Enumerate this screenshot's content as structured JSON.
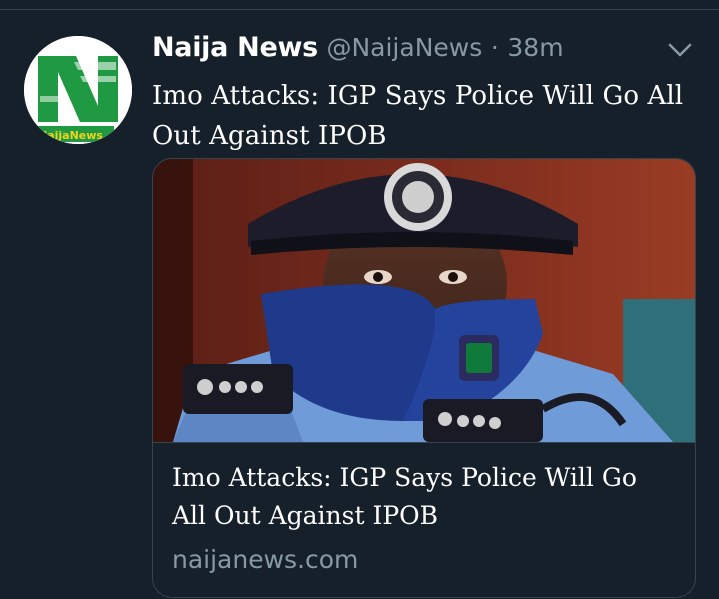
{
  "tweet": {
    "display_name": "Naija News",
    "handle": "@NaijaNews",
    "separator": "·",
    "time": "38m",
    "text": "Imo Attacks: IGP Says Police Will Go All Out Against IPOB",
    "avatar_brand_text": "NaijaNews",
    "menu_icon": "chevron-down-icon"
  },
  "card": {
    "title": "Imo Attacks: IGP Says Police Will Go All Out Against IPOB",
    "domain": "naijanews.com"
  },
  "colors": {
    "background": "#15202b",
    "text_primary": "#ffffff",
    "text_secondary": "#8899a6",
    "border": "#38444d",
    "brand_green": "#1f9a43"
  }
}
